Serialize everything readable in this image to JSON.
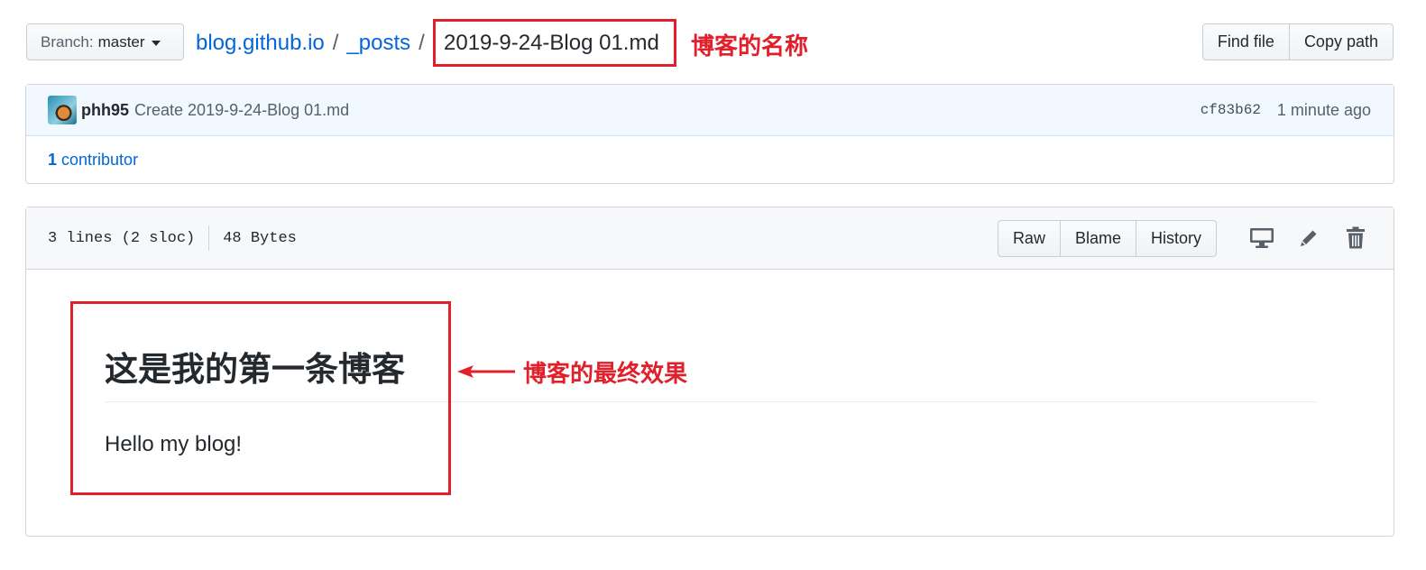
{
  "breadcrumb": {
    "branch_label": "Branch:",
    "branch_name": "master",
    "repo": "blog.github.io",
    "sep1": "/",
    "folder": "_posts",
    "sep2": "/",
    "file": "2019-9-24-Blog 01.md"
  },
  "annotations": {
    "name_note": "博客的名称",
    "result_note": "博客的最终效果",
    "accent_color": "#e0202a"
  },
  "toolbar": {
    "find_file": "Find file",
    "copy_path": "Copy path"
  },
  "commit": {
    "author": "phh95",
    "message": "Create 2019-9-24-Blog 01.md",
    "sha": "cf83b62",
    "time": "1 minute ago",
    "contributors_count": "1",
    "contributors_label": "contributor"
  },
  "file": {
    "lines": "3 lines (2 sloc)",
    "size": "48 Bytes",
    "raw": "Raw",
    "blame": "Blame",
    "history": "History",
    "icons": [
      "desktop-icon",
      "pencil-icon",
      "trash-icon"
    ]
  },
  "content": {
    "heading": "这是我的第一条博客",
    "paragraph": "Hello my blog!"
  }
}
